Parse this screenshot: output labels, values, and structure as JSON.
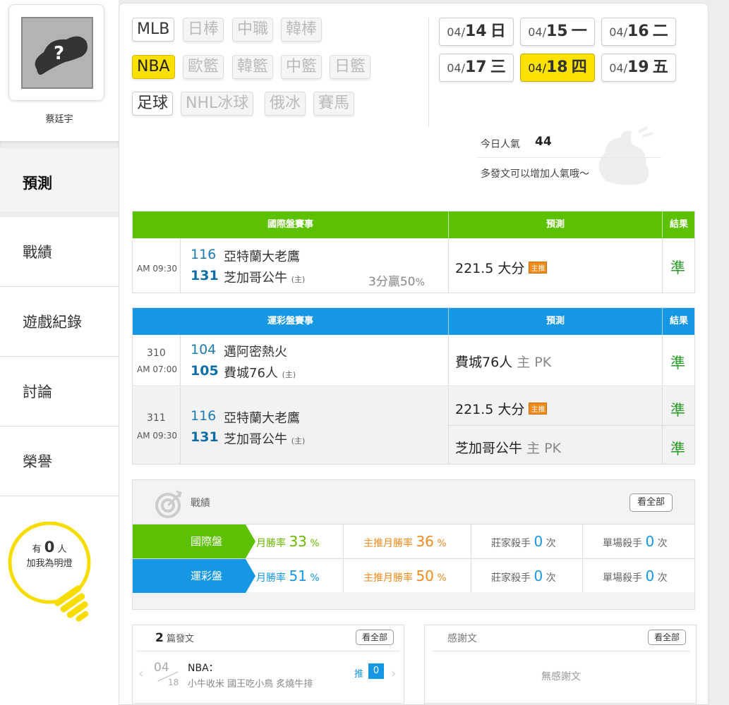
{
  "sidebar": {
    "username": "蔡廷宇",
    "nav": [
      {
        "label": "預測",
        "active": true
      },
      {
        "label": "戰績",
        "active": false
      },
      {
        "label": "遊戲紀錄",
        "active": false
      },
      {
        "label": "討論",
        "active": false
      },
      {
        "label": "榮譽",
        "active": false
      }
    ],
    "bulb": {
      "prefix": "有",
      "count": "0",
      "unit": "人",
      "line2": "加我為明燈"
    }
  },
  "leagues": {
    "row1": [
      "MLB",
      "日棒",
      "中職",
      "韓棒"
    ],
    "row2": [
      "NBA",
      "歐籃",
      "韓籃",
      "中籃",
      "日籃"
    ],
    "row3": [
      "足球",
      "NHL冰球",
      "俄冰",
      "賽馬"
    ],
    "active": "NBA"
  },
  "dates": [
    {
      "md": "04/",
      "day": "14",
      "dow": "日",
      "active": false
    },
    {
      "md": "04/",
      "day": "15",
      "dow": "一",
      "active": false
    },
    {
      "md": "04/",
      "day": "16",
      "dow": "二",
      "active": false
    },
    {
      "md": "04/",
      "day": "17",
      "dow": "三",
      "active": false
    },
    {
      "md": "04/",
      "day": "18",
      "dow": "四",
      "active": true
    },
    {
      "md": "04/",
      "day": "19",
      "dow": "五",
      "active": false
    }
  ],
  "popularity": {
    "label": "今日人氣",
    "value": "44",
    "tip": "多發文可以增加人氣哦～"
  },
  "intl_table": {
    "headers": {
      "event": "國際盤賽事",
      "pred": "預測",
      "result": "結果"
    },
    "rows": [
      {
        "time": "AM 09:30",
        "away_score": "116",
        "away_team": "亞特蘭大老鷹",
        "home_score": "131",
        "home_team": "芝加哥公牛",
        "home_mark": "(主)",
        "stat_prefix": "3分贏",
        "stat_num": "50",
        "stat_unit": "%",
        "pred": "221.5 大分",
        "badge": "主推",
        "result": "準"
      }
    ]
  },
  "sport_table": {
    "headers": {
      "event": "運彩盤賽事",
      "pred": "預測",
      "result": "結果"
    },
    "rows": [
      {
        "no": "310",
        "time": "AM 07:00",
        "away_score": "104",
        "away_team": "邁阿密熱火",
        "home_score": "105",
        "home_team": "費城76人",
        "home_mark": "(主)",
        "pred": "費城76人",
        "pred_suffix": "主 PK",
        "result": "準"
      },
      {
        "no": "311",
        "time": "AM 09:30",
        "away_score": "116",
        "away_team": "亞特蘭大老鷹",
        "home_score": "131",
        "home_team": "芝加哥公牛",
        "home_mark": "(主)",
        "pred": "221.5 大分",
        "badge": "主推",
        "result": "準",
        "pred2": "芝加哥公牛",
        "pred2_suffix": "主 PK",
        "result2": "準"
      }
    ]
  },
  "record": {
    "title": "戰績",
    "view_all": "看全部",
    "rows": [
      {
        "tag": "國際盤",
        "m_label": "月勝率",
        "m_val": "33",
        "r_label": "主推月勝率",
        "r_val": "36",
        "pct": "%",
        "b_label": "莊家殺手",
        "b_val": "0",
        "s_label": "單場殺手",
        "s_val": "0",
        "times": "次"
      },
      {
        "tag": "運彩盤",
        "m_label": "月勝率",
        "m_val": "51",
        "r_label": "主推月勝率",
        "r_val": "50",
        "pct": "%",
        "b_label": "莊家殺手",
        "b_val": "0",
        "s_label": "單場殺手",
        "s_val": "0",
        "times": "次"
      }
    ]
  },
  "posts": {
    "count": "2",
    "label": "篇發文",
    "view_all": "看全部",
    "item": {
      "month": "04",
      "day": "18",
      "title": "NBA：",
      "summary": "小牛收米 國王吃小鳥 炙燒牛排",
      "push_label": "推",
      "push_count": "0"
    }
  },
  "thanks": {
    "title": "感謝文",
    "view_all": "看全部",
    "empty": "無感謝文"
  },
  "colors": {
    "green": "#5cc100",
    "blue": "#1597e3",
    "yellow": "#fbe200",
    "orange": "#f08a1c"
  }
}
